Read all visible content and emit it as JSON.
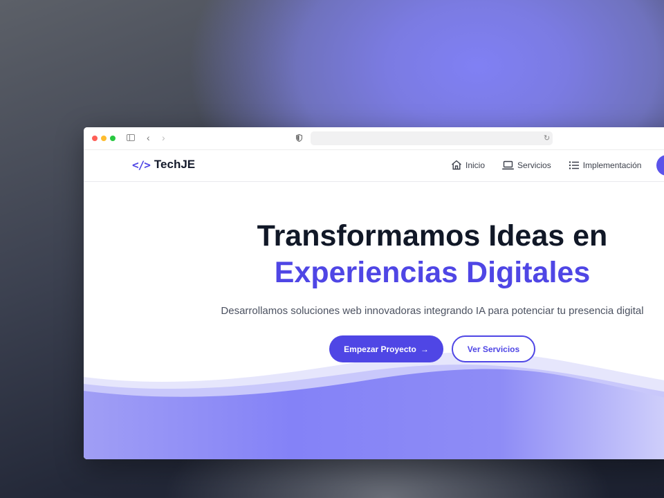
{
  "browser": {
    "url": "",
    "back_glyph": "‹",
    "forward_glyph": "›",
    "reload_glyph": "↻"
  },
  "navbar": {
    "logo_mark": "</>",
    "logo_text": "TechJE",
    "links": [
      {
        "label": "Inicio",
        "icon": "home-icon"
      },
      {
        "label": "Servicios",
        "icon": "laptop-icon"
      },
      {
        "label": "Implementación",
        "icon": "list-icon"
      }
    ]
  },
  "hero": {
    "title_line1": "Transformamos Ideas en",
    "title_line2": "Experiencias Digitales",
    "subtitle": "Desarrollamos soluciones web innovadoras integrando IA para potenciar tu presencia digital",
    "primary_button": "Empezar Proyecto",
    "primary_button_icon": "→",
    "secondary_button": "Ver Servicios"
  },
  "colors": {
    "accent": "#4f46e5",
    "heading": "#111827",
    "wave_light": "#e0e0fb",
    "wave_main": "#8785f7"
  }
}
